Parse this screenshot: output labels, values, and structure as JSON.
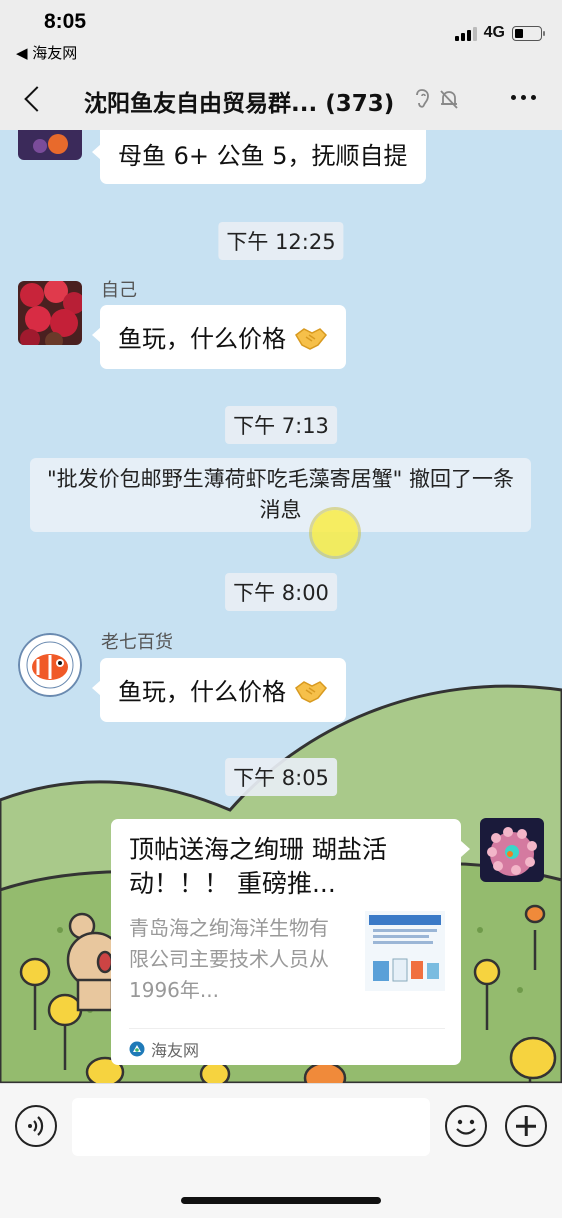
{
  "status_bar": {
    "time": "8:05",
    "back_app": "◀ 海友网",
    "network": "4G",
    "battery_fraction": 0.35,
    "signal_bars": 3
  },
  "nav": {
    "title": "沈阳鱼友自由贸易群... (373)",
    "icons": [
      "ear-icon",
      "mute-bell-icon",
      "more-icon"
    ]
  },
  "messages": {
    "m1": {
      "text": "母鱼 6+ 公鱼 5，抚顺自提"
    },
    "t1": {
      "text": "下午 12:25"
    },
    "m2": {
      "sender": "自己",
      "text": "鱼玩，什么价格"
    },
    "t2": {
      "text": "下午 7:13"
    },
    "recall": {
      "text": "\"批发价包邮野生薄荷虾吃毛藻寄居蟹\" 撤回了一条消息"
    },
    "t3": {
      "text": "下午 8:00"
    },
    "m3": {
      "sender": "老七百货",
      "text": "鱼玩，什么价格"
    },
    "t4": {
      "text": "下午 8:05"
    },
    "card": {
      "title": "顶帖送海之绚珊 瑚盐活动！！！ 重磅推...",
      "description": "青岛海之绚海洋生物有限公司主要技术人员从1996年...",
      "source": "海友网"
    }
  },
  "colors": {
    "chat_bg": "#c7e1f2",
    "bubble_bg": "#ffffff",
    "topbar_bg": "#ededed",
    "hill_green": "#a9c98a"
  }
}
